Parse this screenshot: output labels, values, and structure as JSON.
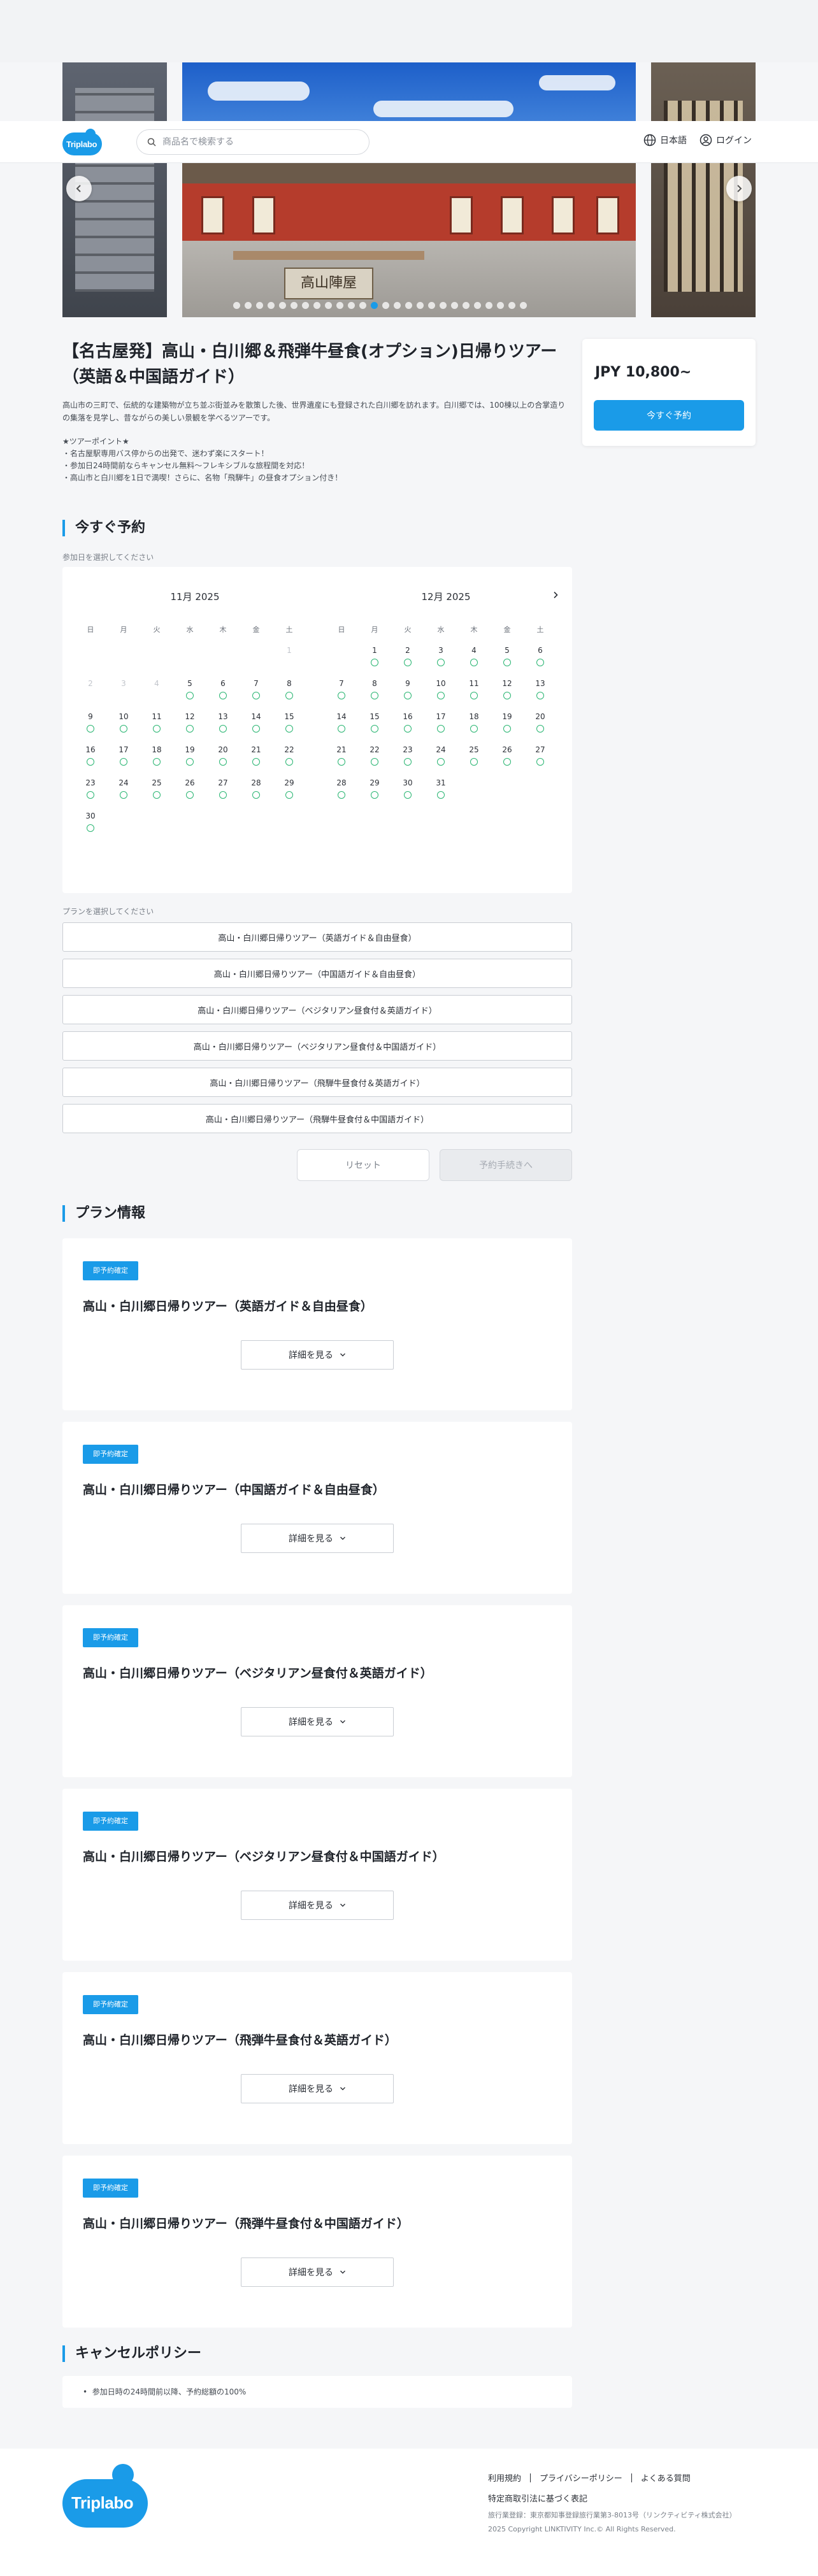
{
  "header": {
    "logo": "Triplabo",
    "search_placeholder": "商品名で検索する",
    "language": "日本語",
    "login": "ログイン"
  },
  "gallery": {
    "sign_text": "高山陣屋",
    "dot_count": 26,
    "active_dot": 12
  },
  "product": {
    "title": "【名古屋発】高山・白川郷＆飛弾牛昼食(オプション)日帰りツアー（英語＆中国語ガイド）",
    "description": "高山市の三町で、伝統的な建築物が立ち並ぶ街並みを散策した後、世界遺産にも登録された白川郷を訪れます。白川郷では、100棟以上の合掌造りの集落を見学し、昔ながらの美しい景観を学べるツアーです。",
    "points_heading": "★ツアーポイント★",
    "points": [
      "・名古屋駅専用バス停からの出発で、迷わず楽にスタート！",
      "・参加日24時間前ならキャンセル無料〜フレキシブルな旅程間を対応！",
      "・高山市と白川郷を1日で満喫！さらに、名物「飛騨牛」の昼食オプション付き！"
    ]
  },
  "price_card": {
    "price": "JPY 10,800~",
    "book_label": "今すぐ予約"
  },
  "booking": {
    "heading": "今すぐ予約",
    "date_prompt": "参加日を選択してください",
    "plan_prompt": "プランを選択してください",
    "weekdays": [
      "日",
      "月",
      "火",
      "水",
      "木",
      "金",
      "土"
    ],
    "months": [
      {
        "title": "11月 2025",
        "offset": 6,
        "days": [
          {
            "d": "1",
            "available": false
          },
          {
            "d": "2",
            "available": false
          },
          {
            "d": "3",
            "available": false
          },
          {
            "d": "4",
            "available": false
          },
          {
            "d": "5",
            "available": true
          },
          {
            "d": "6",
            "available": true
          },
          {
            "d": "7",
            "available": true
          },
          {
            "d": "8",
            "available": true
          },
          {
            "d": "9",
            "available": true
          },
          {
            "d": "10",
            "available": true
          },
          {
            "d": "11",
            "available": true
          },
          {
            "d": "12",
            "available": true
          },
          {
            "d": "13",
            "available": true
          },
          {
            "d": "14",
            "available": true
          },
          {
            "d": "15",
            "available": true
          },
          {
            "d": "16",
            "available": true
          },
          {
            "d": "17",
            "available": true
          },
          {
            "d": "18",
            "available": true
          },
          {
            "d": "19",
            "available": true
          },
          {
            "d": "20",
            "available": true
          },
          {
            "d": "21",
            "available": true
          },
          {
            "d": "22",
            "available": true
          },
          {
            "d": "23",
            "available": true
          },
          {
            "d": "24",
            "available": true
          },
          {
            "d": "25",
            "available": true
          },
          {
            "d": "26",
            "available": true
          },
          {
            "d": "27",
            "available": true
          },
          {
            "d": "28",
            "available": true
          },
          {
            "d": "29",
            "available": true
          },
          {
            "d": "30",
            "available": true
          }
        ]
      },
      {
        "title": "12月 2025",
        "offset": 1,
        "days": [
          {
            "d": "1",
            "available": true
          },
          {
            "d": "2",
            "available": true
          },
          {
            "d": "3",
            "available": true
          },
          {
            "d": "4",
            "available": true
          },
          {
            "d": "5",
            "available": true
          },
          {
            "d": "6",
            "available": true
          },
          {
            "d": "7",
            "available": true
          },
          {
            "d": "8",
            "available": true
          },
          {
            "d": "9",
            "available": true
          },
          {
            "d": "10",
            "available": true
          },
          {
            "d": "11",
            "available": true
          },
          {
            "d": "12",
            "available": true
          },
          {
            "d": "13",
            "available": true
          },
          {
            "d": "14",
            "available": true
          },
          {
            "d": "15",
            "available": true
          },
          {
            "d": "16",
            "available": true
          },
          {
            "d": "17",
            "available": true
          },
          {
            "d": "18",
            "available": true
          },
          {
            "d": "19",
            "available": true
          },
          {
            "d": "20",
            "available": true
          },
          {
            "d": "21",
            "available": true
          },
          {
            "d": "22",
            "available": true
          },
          {
            "d": "23",
            "available": true
          },
          {
            "d": "24",
            "available": true
          },
          {
            "d": "25",
            "available": true
          },
          {
            "d": "26",
            "available": true
          },
          {
            "d": "27",
            "available": true
          },
          {
            "d": "28",
            "available": true
          },
          {
            "d": "29",
            "available": true
          },
          {
            "d": "30",
            "available": true
          },
          {
            "d": "31",
            "available": true
          }
        ]
      }
    ],
    "plans": [
      "高山・白川郷日帰りツアー（英語ガイド＆自由昼食）",
      "高山・白川郷日帰りツアー（中国語ガイド＆自由昼食）",
      "高山・白川郷日帰りツアー（ベジタリアン昼食付＆英語ガイド）",
      "高山・白川郷日帰りツアー（ベジタリアン昼食付＆中国語ガイド）",
      "高山・白川郷日帰りツアー（飛騨牛昼食付＆英語ガイド）",
      "高山・白川郷日帰りツアー（飛騨牛昼食付＆中国語ガイド）"
    ],
    "reset_label": "リセット",
    "next_label": "予約手続きへ"
  },
  "plan_info": {
    "heading": "プラン情報",
    "badge": "即予約確定",
    "more_label": "詳細を見る",
    "cards": [
      "高山・白川郷日帰りツアー（英語ガイド＆自由昼食）",
      "高山・白川郷日帰りツアー（中国語ガイド＆自由昼食）",
      "高山・白川郷日帰りツアー（ベジタリアン昼食付＆英語ガイド）",
      "高山・白川郷日帰りツアー（ベジタリアン昼食付＆中国語ガイド）",
      "高山・白川郷日帰りツアー（飛弾牛昼食付＆英語ガイド）",
      "高山・白川郷日帰りツアー（飛弾牛昼食付＆中国語ガイド）"
    ]
  },
  "cancel_policy": {
    "heading": "キャンセルポリシー",
    "item": "参加日時の24時間前以降、予約総額の100%"
  },
  "footer": {
    "logo": "Triplabo",
    "links": [
      "利用規約",
      "プライバシーポリシー",
      "よくある質問"
    ],
    "law": "特定商取引法に基づく表記",
    "license": "旅行業登録：東京都知事登録旅行業第3-8013号（リンクティビティ株式会社）",
    "copyright": "2025 Copyright LINKTIVITY Inc.© All Rights Reserved."
  },
  "colors": {
    "accent": "#1a9be8",
    "available": "#2bb673",
    "background": "#f5f6f8"
  }
}
